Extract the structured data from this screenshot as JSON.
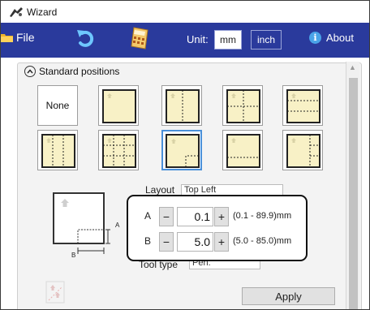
{
  "window": {
    "title": "Wizard"
  },
  "toolbar": {
    "file_label": "File",
    "unit_label": "Unit:",
    "unit_mm": "mm",
    "unit_inch": "inch",
    "selected_unit": "mm",
    "about_label": "About",
    "background_color": "#2a3a9c",
    "icons": [
      "folder-icon",
      "undo-icon",
      "calculator-icon",
      "info-icon"
    ]
  },
  "section": {
    "title": "Standard positions",
    "tiles": [
      {
        "label": "None",
        "selected": false
      },
      {
        "label": "",
        "selected": false
      },
      {
        "label": "",
        "selected": false
      },
      {
        "label": "",
        "selected": false
      },
      {
        "label": "",
        "selected": false
      },
      {
        "label": "",
        "selected": false
      },
      {
        "label": "",
        "selected": false
      },
      {
        "label": "",
        "selected": true
      },
      {
        "label": "",
        "selected": false
      },
      {
        "label": "",
        "selected": false
      }
    ]
  },
  "layout_field": {
    "label": "Layout",
    "value": "Top Left"
  },
  "tool_type_field": {
    "label": "Tool type",
    "value": "Pen."
  },
  "preview": {
    "label_a": "A",
    "label_b": "B"
  },
  "margins": {
    "a": {
      "label": "A",
      "value": "0.1",
      "range": "(0.1 - 89.9)mm",
      "minus": "−",
      "plus": "+"
    },
    "b": {
      "label": "B",
      "value": "5.0",
      "range": "(5.0 - 85.0)mm",
      "minus": "−",
      "plus": "+"
    }
  },
  "apply_label": "Apply",
  "colors": {
    "tile_fill": "#f8f1c6",
    "selected_border": "#4a90d9"
  }
}
